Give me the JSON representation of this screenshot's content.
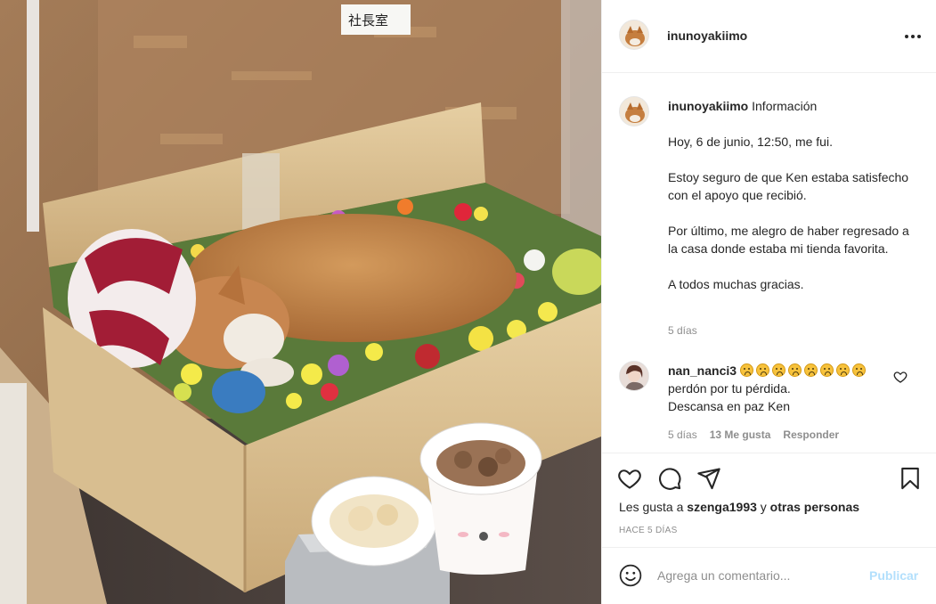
{
  "photo": {
    "sign_text": "社長室"
  },
  "header": {
    "username": "inunoyakiimo"
  },
  "caption": {
    "username": "inunoyakiimo",
    "first_line": "Información",
    "paragraphs": [
      "Hoy, 6 de junio, 12:50, me fui.",
      "Estoy seguro de que Ken estaba satisfecho con el apoyo que recibió.",
      "Por último, me alegro de haber regresado a la casa donde estaba mi tienda favorita.",
      "A todos muchas gracias."
    ],
    "time": "5 días"
  },
  "comment": {
    "username": "nan_nanci3",
    "emoji_icon": "sad-face-emoji",
    "text": "perdón por tu pérdida.",
    "line2": "Descansa en paz Ken",
    "time": "5 días",
    "likes": "13 Me gusta",
    "reply": "Responder"
  },
  "actions": {
    "likes_prefix": "Les gusta a",
    "liker": "szenga1993",
    "likes_join": "y",
    "others": "otras personas",
    "posted": "HACE 5 DÍAS"
  },
  "add_comment": {
    "placeholder": "Agrega un comentario...",
    "publish": "Publicar"
  },
  "colors": {
    "text": "#262626",
    "muted": "#8e8e8e",
    "publish_disabled": "#b2dffc",
    "divider": "#efefef"
  }
}
